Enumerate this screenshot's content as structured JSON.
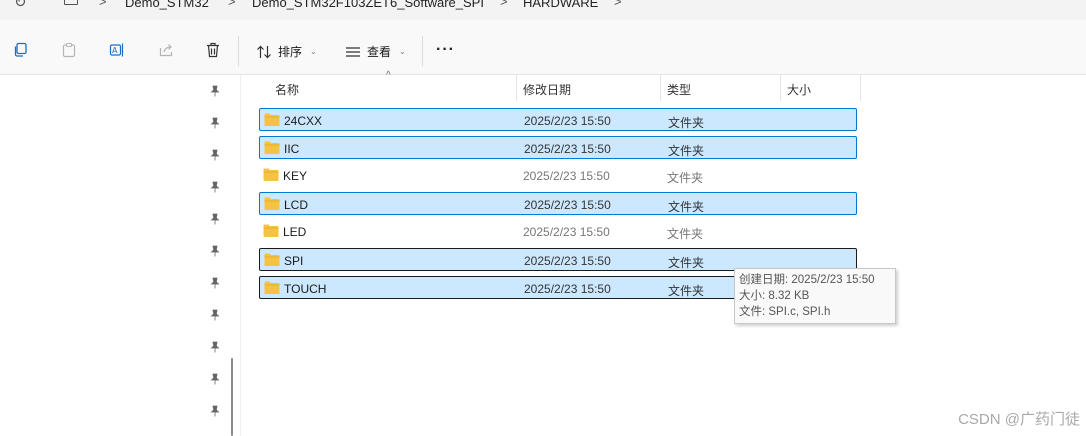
{
  "address_bar": {
    "crumbs": [
      "Demo_STM32",
      "Demo_STM32F103ZET6_Software_SPI",
      "HARDWARE"
    ],
    "separator": ">"
  },
  "toolbar": {
    "sort_label": "排序",
    "view_label": "查看",
    "more_label": "···",
    "icons": [
      "copy-icon",
      "paste-icon",
      "rename-icon",
      "share-icon",
      "delete-icon"
    ]
  },
  "columns": {
    "name": "名称",
    "date": "修改日期",
    "type": "类型",
    "size": "大小"
  },
  "files": [
    {
      "name": "24CXX",
      "date": "2025/2/23 15:50",
      "type": "文件夹",
      "selected": true
    },
    {
      "name": "IIC",
      "date": "2025/2/23 15:50",
      "type": "文件夹",
      "selected": true
    },
    {
      "name": "KEY",
      "date": "2025/2/23 15:50",
      "type": "文件夹",
      "selected": false
    },
    {
      "name": "LCD",
      "date": "2025/2/23 15:50",
      "type": "文件夹",
      "selected": true
    },
    {
      "name": "LED",
      "date": "2025/2/23 15:50",
      "type": "文件夹",
      "selected": false
    },
    {
      "name": "SPI",
      "date": "2025/2/23 15:50",
      "type": "文件夹",
      "selected": true
    },
    {
      "name": "TOUCH",
      "date": "2025/2/23 15:50",
      "type": "文件夹",
      "selected": true
    }
  ],
  "tooltip": {
    "created": "创建日期: 2025/2/23 15:50",
    "size": "大小: 8.32 KB",
    "files": "文件: SPI.c, SPI.h"
  },
  "watermark": "CSDN @广药门徒",
  "colors": {
    "selection_bg": "#cce8ff",
    "selection_border": "#0078d4",
    "folder": "#f5c343"
  }
}
